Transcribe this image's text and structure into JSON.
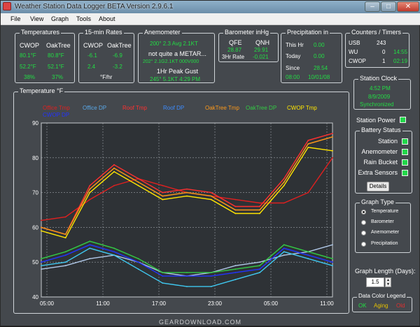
{
  "window": {
    "title": "Weather Station Data Logger  BETA Version 2.9.6.1"
  },
  "menu": [
    "File",
    "View",
    "Graph",
    "Tools",
    "About"
  ],
  "temperatures": {
    "title": "Temperatures",
    "col1": "CWOP",
    "col2": "OakTree",
    "r1c1": "80.1°F",
    "r1c2": "80.8°F",
    "r2c1": "52.2°F",
    "r2c2": "52.1°F",
    "r3c1": "38%",
    "r3c2": "37%"
  },
  "rates": {
    "title": "15-min Rates",
    "col1": "CWOP",
    "col2": "OakTree",
    "r1c1": "-6.1",
    "r1c2": "-6.9",
    "r2c1": "2.4",
    "r2c2": "-3.2",
    "unit": "°F/hr"
  },
  "anemometer": {
    "title": "Anemometer",
    "line1": "200° 2.3 Avg 2.1KT",
    "line2": "not quite a METAR...",
    "line3": "202° 2.1G2.1KT 000V000",
    "line4": "1Hr Peak Gust",
    "line5": "245° 5.1KT 4:29 PM"
  },
  "barometer": {
    "title": "Barometer inHg",
    "qfe_label": "QFE",
    "qnh_label": "QNH",
    "qfe": "28.87",
    "qnh": "29.91",
    "rate_label": "3Hr Rate",
    "rate": "-0.021"
  },
  "precip": {
    "title": "Precipitation  in",
    "hr_label": "This Hr",
    "hr": "0.00",
    "today_label": "Today",
    "today": "0.00",
    "since_label": "Since",
    "since": "28.54",
    "since_time": "08:00",
    "since_date": "10/01/08"
  },
  "counters": {
    "title": "Counters / Timers",
    "r1_label": "USB",
    "r1_count": "243",
    "r1_time": "",
    "r2_label": "WU",
    "r2_count": "0",
    "r2_time": "14:55",
    "r3_label": "CWOP",
    "r3_count": "1",
    "r3_time": "02:19"
  },
  "clock": {
    "title": "Station Clock",
    "time": "4:52 PM",
    "date": "8/9/2009",
    "status": "Synchronized"
  },
  "power": {
    "label": "Station Power"
  },
  "battery": {
    "title": "Battery Status",
    "station": "Station",
    "anemometer": "Anemometer",
    "rain": "Rain Bucket",
    "extra": "Extra Sensors",
    "details": "Details"
  },
  "graph_type": {
    "title": "Graph Type",
    "options": [
      "Temperature",
      "Barometer",
      "Anemometer",
      "Precipitation"
    ]
  },
  "graph_length": {
    "label": "Graph Length (Days):",
    "value": "1.5"
  },
  "legend_box": {
    "title": "Data Color Legend",
    "ok": "OK",
    "aging": "Aging",
    "old": "Old"
  },
  "colors": {
    "office_tmp": "#e02020",
    "office_dp": "#5aa8e8",
    "roof_tmp": "#ff3030",
    "roof_dp": "#3c8cff",
    "oaktree_tmp": "#ff9a1a",
    "oaktree_dp": "#33cc44",
    "cwop_tmp": "#ffe600",
    "cwop_dp": "#2233ff"
  },
  "chart_data": {
    "type": "line",
    "title": "Temperature °F",
    "xlabel": "",
    "ylabel": "",
    "ylim": [
      40,
      90
    ],
    "yticks": [
      "40",
      "50",
      "60",
      "70",
      "80",
      "90"
    ],
    "xticks": [
      "05:00",
      "11:00",
      "17:00",
      "23:00",
      "05:00",
      "11:00"
    ],
    "x": [
      0,
      3,
      6,
      9,
      12,
      15,
      18,
      21,
      24,
      27,
      30,
      33,
      36
    ],
    "legend": [
      "Office Tmp",
      "Office DP",
      "Roof Tmp",
      "Roof DP",
      "OakTree Tmp",
      "OakTree DP",
      "CWOP Tmp",
      "CWOP DP"
    ],
    "series": [
      {
        "name": "Office Tmp",
        "color": "#e02020",
        "values": [
          62,
          63,
          68,
          72,
          74,
          72,
          70,
          69,
          68,
          67,
          67,
          70,
          80
        ]
      },
      {
        "name": "Office DP",
        "color": "#b0c8e8",
        "values": [
          48,
          49,
          51,
          52,
          50,
          47,
          46,
          47,
          49,
          50,
          52,
          53,
          55
        ]
      },
      {
        "name": "Roof Tmp",
        "color": "#ff3030",
        "values": [
          60,
          58,
          72,
          78,
          74,
          70,
          71,
          70,
          66,
          66,
          74,
          85,
          87
        ]
      },
      {
        "name": "Roof DP",
        "color": "#3fc8f0",
        "values": [
          49,
          50,
          54,
          52,
          48,
          44,
          43,
          43,
          45,
          47,
          53,
          51,
          49
        ]
      },
      {
        "name": "OakTree Tmp",
        "color": "#ff9a1a",
        "values": [
          60,
          58,
          71,
          77,
          73,
          69,
          70,
          69,
          65,
          65,
          73,
          84,
          86
        ]
      },
      {
        "name": "OakTree DP",
        "color": "#33cc44",
        "values": [
          51,
          53,
          56,
          54,
          51,
          47,
          47,
          47,
          48,
          49,
          55,
          53,
          51
        ]
      },
      {
        "name": "CWOP Tmp",
        "color": "#ffe600",
        "values": [
          59,
          57,
          70,
          76,
          72,
          68,
          69,
          68,
          64,
          64,
          72,
          83,
          82
        ]
      },
      {
        "name": "CWOP DP",
        "color": "#2233ff",
        "values": [
          50,
          52,
          55,
          53,
          50,
          46,
          46,
          46,
          47,
          48,
          54,
          52,
          50
        ]
      }
    ],
    "grid": true
  },
  "watermark": "GEARDOWNLOAD.COM"
}
